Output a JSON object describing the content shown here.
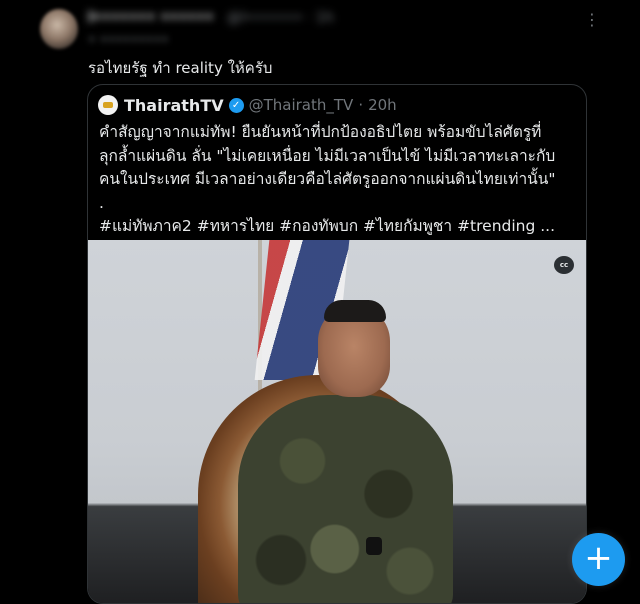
{
  "post": {
    "author_name": "l••••••• ••••••",
    "author_meta": "@l•••••••  ·  1h",
    "author_sub": "•  •••••••••",
    "more_icon": "⋮",
    "text": "รอไทยรัฐ ทำ reality ให้ครับ"
  },
  "quote": {
    "name": "ThairathTV",
    "verified_icon": "✓",
    "handle": "@Thairath_TV",
    "separator": "·",
    "time": "20h",
    "lines": [
      "คำสัญญาจากแม่ทัพ! ยืนยันหน้าที่ปกป้องอธิปไตย พร้อมขับไล่ศัตรูที่",
      "ลุกล้ำแผ่นดิน ลั่น \"ไม่เคยเหนื่อย ไม่มีเวลาเป็นไข้ ไม่มีเวลาทะเลาะกับ",
      "คนในประเทศ มีเวลาอย่างเดียวคือไล่ศัตรูออกจากแผ่นดินไทยเท่านั้น\"",
      ".",
      "#แม่ทัพภาค2 #ทหารไทย #กองทัพบก #ไทยกัมพูชา #trending ..."
    ],
    "cc_label": "cc"
  },
  "fab": {
    "icon": "+"
  },
  "colors": {
    "background": "#000000",
    "text": "#e7e9ea",
    "muted": "#71767b",
    "accent": "#1d9bf0",
    "border": "#2f3336"
  }
}
